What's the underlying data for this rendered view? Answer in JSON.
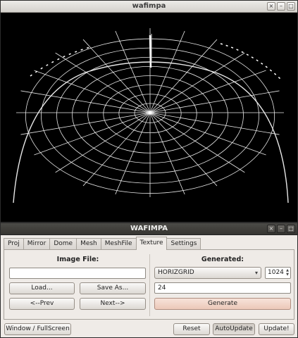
{
  "viewer_window": {
    "title": "wafimpa",
    "controls": [
      "close-icon",
      "minimize-icon",
      "maximize-icon"
    ]
  },
  "control_window": {
    "title": "WAFIMPA",
    "tabs": [
      {
        "label": "Proj"
      },
      {
        "label": "Mirror"
      },
      {
        "label": "Dome"
      },
      {
        "label": "Mesh"
      },
      {
        "label": "MeshFile"
      },
      {
        "label": "Texture",
        "active": true
      },
      {
        "label": "Settings"
      }
    ],
    "image_file": {
      "heading": "Image File:",
      "path_value": "",
      "load_label": "Load...",
      "save_as_label": "Save As...",
      "prev_label": "<--Prev",
      "next_label": "Next-->"
    },
    "generated": {
      "heading": "Generated:",
      "pattern_selected": "HORIZGRID",
      "resolution": "1024",
      "divisions": "24",
      "generate_label": "Generate"
    },
    "bottom": {
      "fullscreen_label": "Window / FullScreen",
      "reset_label": "Reset",
      "autoupdate_label": "AutoUpdate",
      "update_label": "Update!"
    }
  },
  "colors": {
    "grid_line": "#e8e8e8",
    "generate_button": "#ecc8b8",
    "window_background": "#efebe7"
  }
}
